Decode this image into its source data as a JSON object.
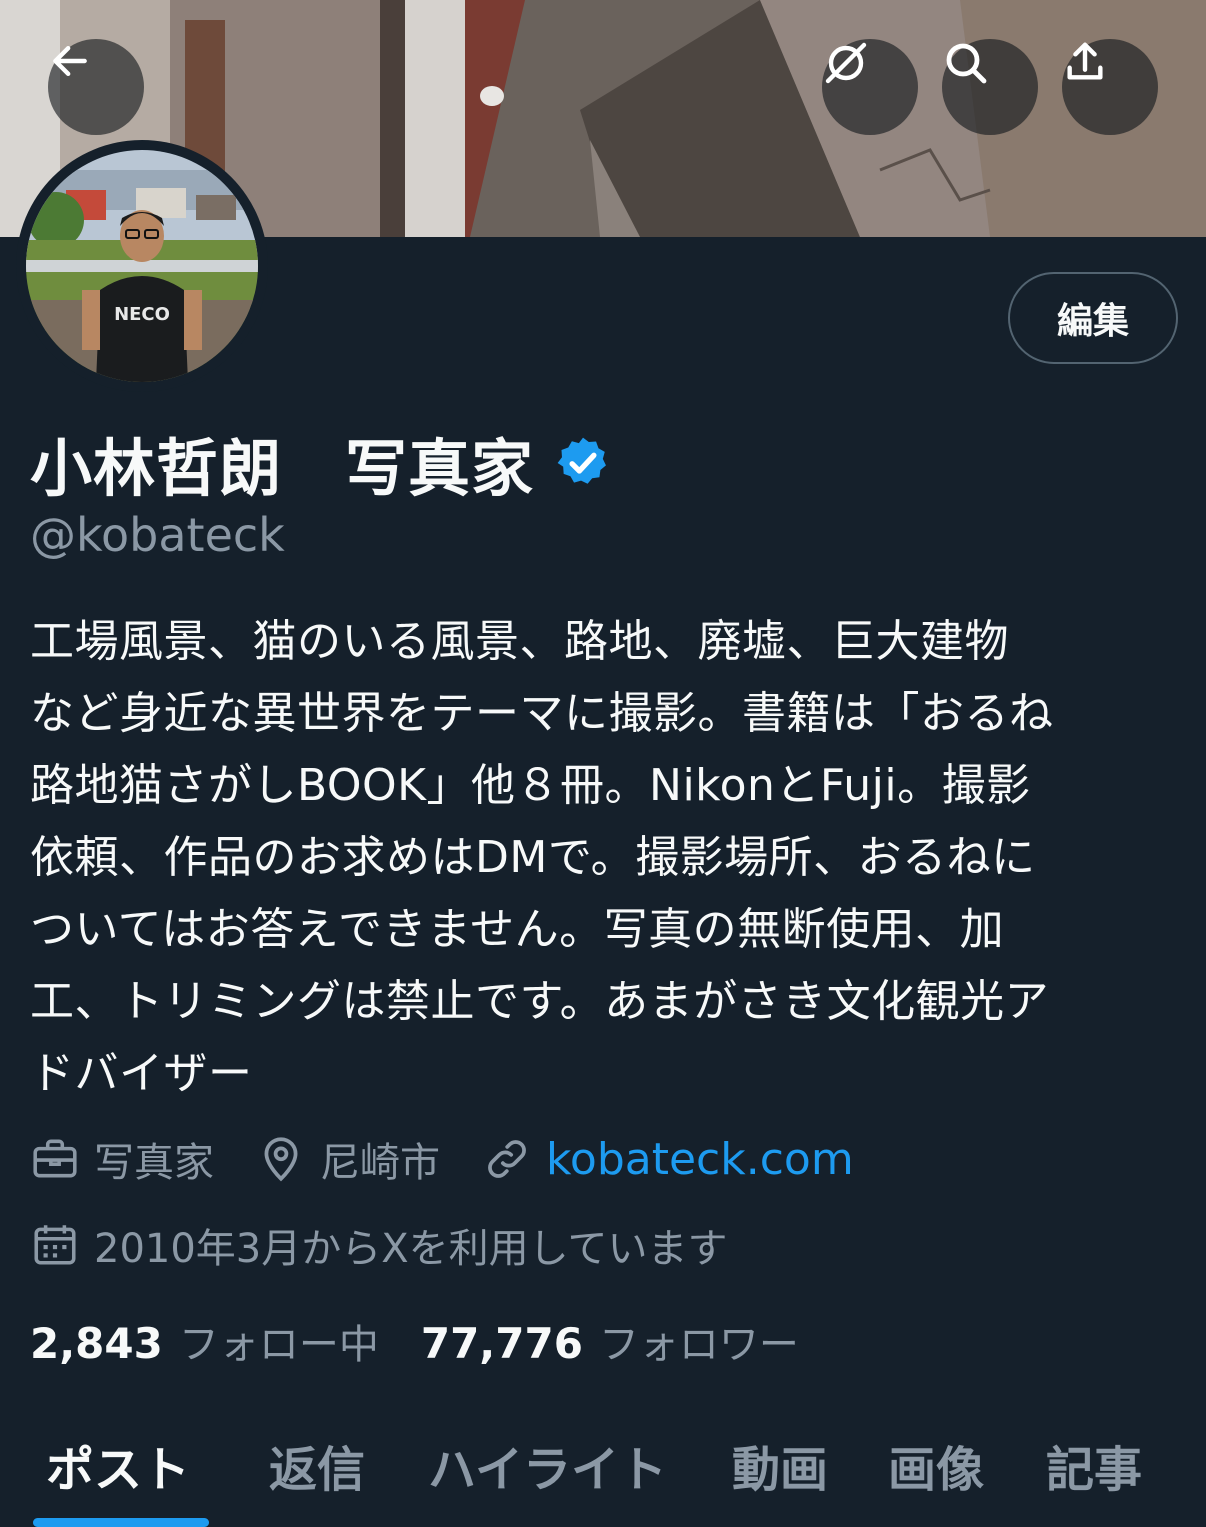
{
  "header": {
    "back_icon": "arrow-left-icon",
    "grok_icon": "grok-slash-circle-icon",
    "search_icon": "search-icon",
    "share_icon": "share-upload-icon"
  },
  "profile": {
    "edit_label": "編集",
    "display_name": "小林哲朗　写真家",
    "verified": true,
    "verified_color": "#1d9bf0",
    "handle": "@kobateck",
    "bio_lines": [
      "工場風景、猫のいる風景、路地、廃墟、巨大建物",
      "など身近な異世界をテーマに撮影。書籍は「おるね",
      "路地猫さがしBOOK」他８冊。NikonとFuji。撮影",
      "依頼、作品のお求めはDMで。撮影場所、おるねに",
      "ついてはお答えできません。写真の無断使用、加",
      "工、トリミングは禁止です。あまがさき文化観光ア",
      "ドバイザー"
    ],
    "job": "写真家",
    "location": "尼崎市",
    "website": "kobateck.com",
    "joined": "2010年3月からXを利用しています",
    "following_count": "2,843",
    "following_label": "フォロー中",
    "followers_count": "77,776",
    "followers_label": "フォロワー",
    "avatar_shirt_text": "NECO"
  },
  "tabs": [
    "ポスト",
    "返信",
    "ハイライト",
    "動画",
    "画像",
    "記事"
  ],
  "active_tab": "ポスト",
  "colors": {
    "background": "#15202b",
    "accent": "#1d9bf0",
    "muted_text": "#8b98a5",
    "primary_text": "#f7f9f9"
  }
}
